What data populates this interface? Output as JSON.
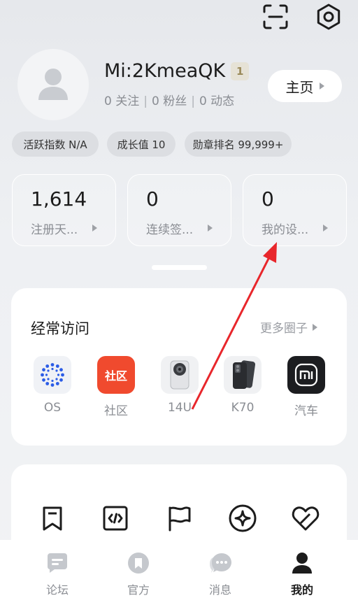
{
  "profile": {
    "username": "Mi:2KmeaQK",
    "level": "1",
    "follow_count": "0",
    "follow_label": "关注",
    "fans_count": "0",
    "fans_label": "粉丝",
    "posts_count": "0",
    "posts_label": "动态",
    "home_button": "主页"
  },
  "chips": [
    {
      "label": "活跃指数 N/A"
    },
    {
      "label": "成长值 10"
    },
    {
      "label": "勋章排名 99,999+"
    }
  ],
  "stat_cards": [
    {
      "value": "1,614",
      "label": "注册天..."
    },
    {
      "value": "0",
      "label": "连续签..."
    },
    {
      "value": "0",
      "label": "我的设..."
    }
  ],
  "frequent": {
    "title": "经常访问",
    "more": "更多圈子",
    "items": [
      {
        "label": "OS",
        "icon": "os-logo-icon"
      },
      {
        "label": "社区",
        "icon": "community-icon",
        "badge_text": "社区"
      },
      {
        "label": "14U",
        "icon": "phone-14u-icon"
      },
      {
        "label": "K70",
        "icon": "phone-k70-icon"
      },
      {
        "label": "汽车",
        "icon": "mi-car-icon"
      }
    ]
  },
  "tabs": [
    {
      "label": "论坛",
      "icon": "forum-icon"
    },
    {
      "label": "官方",
      "icon": "official-icon"
    },
    {
      "label": "消息",
      "icon": "message-icon"
    },
    {
      "label": "我的",
      "icon": "me-icon",
      "active": true
    }
  ],
  "colors": {
    "accent_red": "#f04a2e",
    "annotation_arrow": "#e8262b",
    "text_primary": "#1c1c1c",
    "text_secondary": "#8a8d93"
  }
}
